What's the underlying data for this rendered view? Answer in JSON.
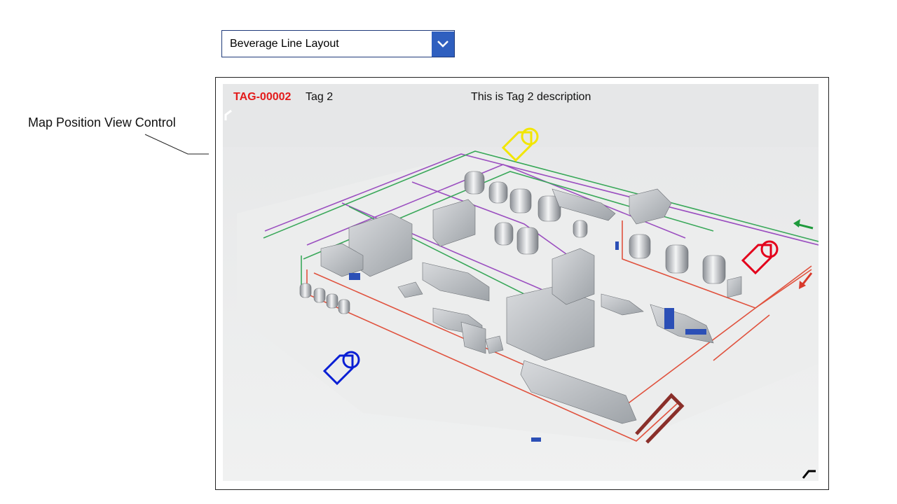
{
  "dropdown": {
    "selected": "Beverage Line Layout",
    "icon": "chevron-down-icon"
  },
  "annotation": {
    "label": "Map Position View Control"
  },
  "tag_header": {
    "id": "TAG-00002",
    "name": "Tag 2",
    "description": "This is Tag 2 description"
  },
  "colors": {
    "tag_id": "#e31b1b",
    "pin_yellow": "#f2e600",
    "pin_red": "#e3001b",
    "pin_blue": "#0a1fd4",
    "pipe_green": "#3aa85a",
    "pipe_purple": "#9b4fc0",
    "pipe_red": "#e0523e"
  },
  "pins": [
    {
      "name": "tag-pin-yellow",
      "icon": "tag-icon",
      "color": "#f2e600"
    },
    {
      "name": "tag-pin-red",
      "icon": "tag-icon",
      "color": "#e3001b"
    },
    {
      "name": "tag-pin-blue",
      "icon": "tag-icon",
      "color": "#0a1fd4"
    }
  ]
}
